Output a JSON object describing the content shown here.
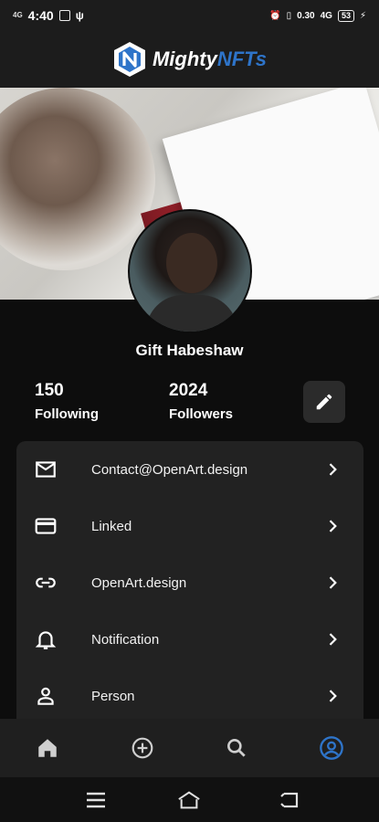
{
  "status_bar": {
    "time": "4:40",
    "left_signal": "4G",
    "right_speed": "0.30",
    "right_network": "4G",
    "battery": "53"
  },
  "app": {
    "brand_prefix": "Mighty",
    "brand_accent": "NFTs",
    "accent_color": "#2e74c9"
  },
  "profile": {
    "name": "Gift Habeshaw",
    "following_count": "150",
    "following_label": "Following",
    "followers_count": "2024",
    "followers_label": "Followers"
  },
  "menu": [
    {
      "label": "Contact@OpenArt.design",
      "icon": "mail-icon"
    },
    {
      "label": "Linked",
      "icon": "credit-card-icon"
    },
    {
      "label": "OpenArt.design",
      "icon": "link-icon"
    },
    {
      "label": "Notification",
      "icon": "bell-icon"
    },
    {
      "label": "Person",
      "icon": "person-icon"
    }
  ],
  "bottom_nav": [
    {
      "icon": "home-icon",
      "active": false
    },
    {
      "icon": "add-circle-icon",
      "active": false
    },
    {
      "icon": "search-icon",
      "active": false
    },
    {
      "icon": "account-circle-icon",
      "active": true
    }
  ]
}
